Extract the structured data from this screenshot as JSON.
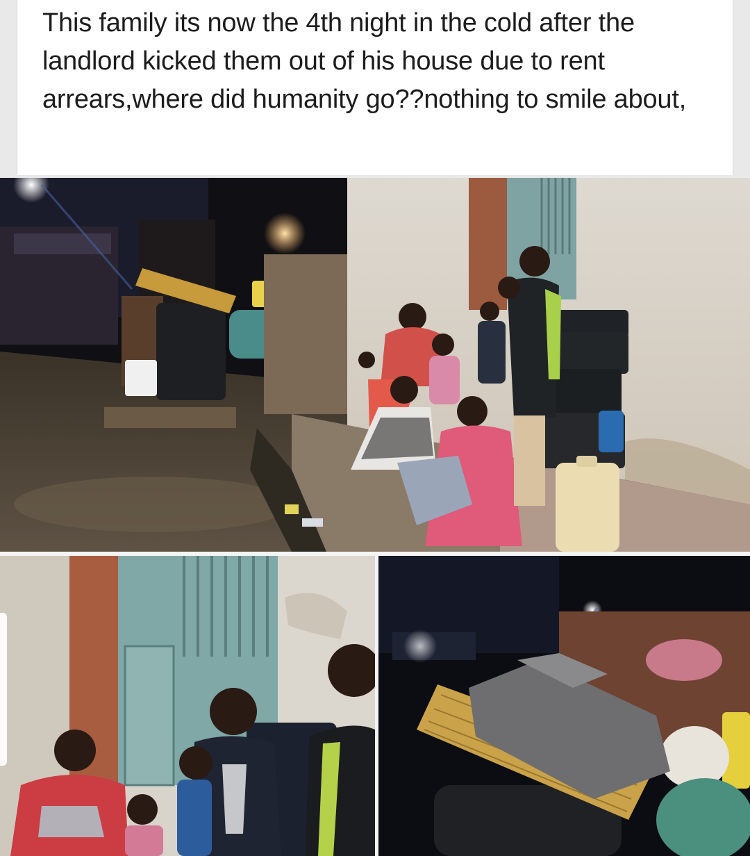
{
  "post": {
    "text": "This family its now the 4th night in the cold after the landlord kicked them out of his house due to rent arrears,where did humanity go??nothing to smile about,"
  },
  "photos": [
    {
      "name": "family-outside-house-photo"
    },
    {
      "name": "family-closeup-photo"
    },
    {
      "name": "household-items-photo"
    }
  ],
  "colors": {
    "page_background": "#e9e9ea",
    "card_background": "#ffffff",
    "text": "#1c1c1c"
  }
}
